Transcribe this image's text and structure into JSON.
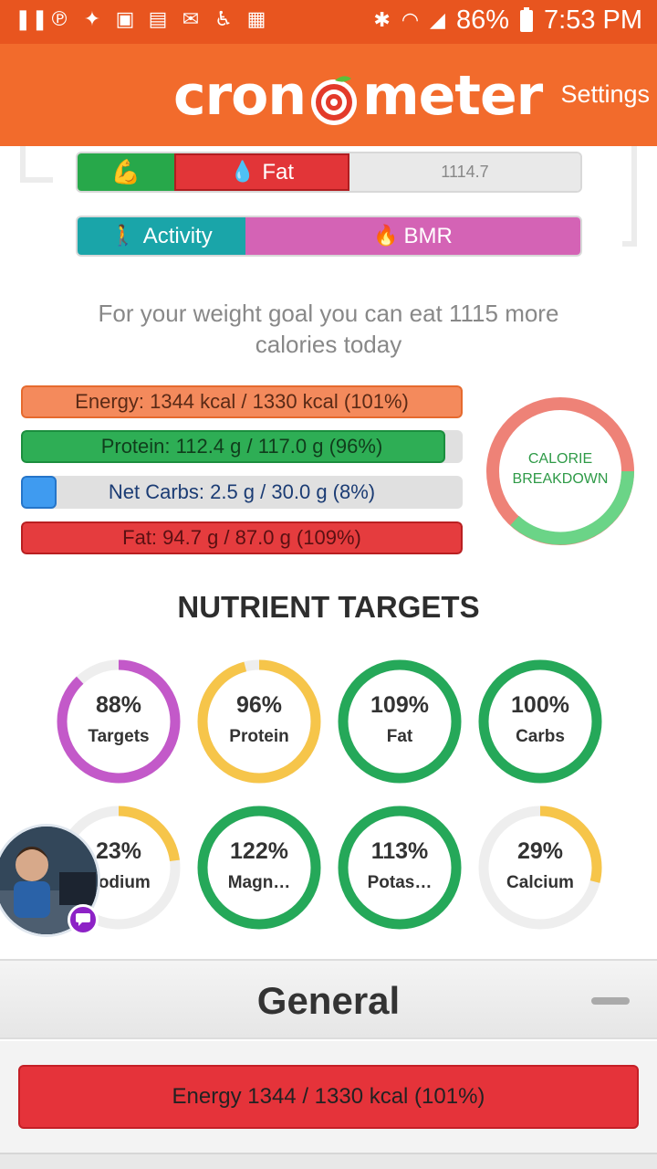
{
  "status_bar": {
    "left_icons": [
      "pause-icon",
      "pinterest-icon",
      "twitter-icon",
      "credit-karma-icon",
      "flipboard-icon",
      "gmail-icon",
      "accessibility-icon",
      "calendar-icon"
    ],
    "battery": "86%",
    "time": "7:53 PM"
  },
  "app": {
    "logo_left": "cron",
    "logo_right": "meter",
    "settings_label": "Settings"
  },
  "burned_bar": {
    "fat_label": "Fat",
    "remaining_value": "1114.7"
  },
  "expenditure_bar": {
    "activity_label": "Activity",
    "bmr_label": "BMR"
  },
  "goal_message": "For your weight goal you can eat 1115 more calories today",
  "nutrient_bars": [
    {
      "key": "energy",
      "label": "Energy: 1344 kcal  /  1330 kcal (101%)",
      "percent": 101
    },
    {
      "key": "protein",
      "label": "Protein: 112.4 g  /  117.0 g (96%)",
      "percent": 96
    },
    {
      "key": "carbs",
      "label": "Net Carbs: 2.5 g  /  30.0 g (8%)",
      "percent": 8
    },
    {
      "key": "fat",
      "label": "Fat: 94.7 g  /  87.0 g (109%)",
      "percent": 109
    }
  ],
  "calorie_breakdown": {
    "line1": "CALORIE",
    "line2": "BREAKDOWN",
    "colors": {
      "fat": "#ee8277",
      "protein": "#6bd487"
    }
  },
  "nutrient_targets": {
    "title": "NUTRIENT TARGETS",
    "rings": [
      {
        "pct": "88%",
        "name": "Targets",
        "value": 0.88,
        "color": "#c359c9"
      },
      {
        "pct": "96%",
        "name": "Protein",
        "value": 0.96,
        "color": "#f6c54a"
      },
      {
        "pct": "109%",
        "name": "Fat",
        "value": 1.0,
        "color": "#25a859"
      },
      {
        "pct": "100%",
        "name": "Carbs",
        "value": 1.0,
        "color": "#25a859"
      },
      {
        "pct": "23%",
        "name": "Sodium",
        "value": 0.23,
        "color": "#f6c54a"
      },
      {
        "pct": "122%",
        "name": "Magn…",
        "value": 1.0,
        "color": "#25a859"
      },
      {
        "pct": "113%",
        "name": "Potas…",
        "value": 1.0,
        "color": "#25a859"
      },
      {
        "pct": "29%",
        "name": "Calcium",
        "value": 0.29,
        "color": "#f6c54a"
      }
    ]
  },
  "general_section": {
    "title": "General",
    "energy_label": "Energy 1344 / 1330 kcal (101%)"
  }
}
